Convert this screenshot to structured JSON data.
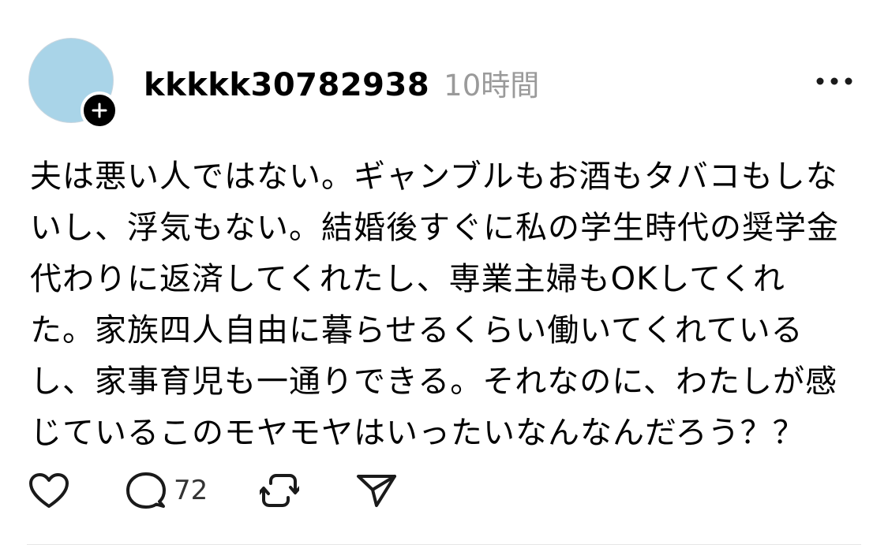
{
  "post": {
    "username": "kkkkk30782938",
    "timestamp": "10時間",
    "body": "夫は悪い人ではない。ギャンブルもお酒もタバコもしな\nいし、浮気もない。結婚後すぐに私の学生時代の奨学金\n代わりに返済してくれたし、専業主婦もOKしてくれ\nた。家族四人自由に暮らせるくらい働いてくれている\nし、家事育児も一通りできる。それなのに、わたしが感\nじているこのモヤモヤはいったいなんなんだろう？？",
    "reply_count": "72"
  },
  "icons": {
    "avatar": "avatar-placeholder",
    "follow": "plus-icon",
    "more": "more-horizontal-icon",
    "like": "heart-icon",
    "reply": "speech-bubble-icon",
    "repost": "repost-icon",
    "share": "send-icon"
  },
  "colors": {
    "avatar_fill": "#a9d4e8",
    "follow_badge": "#000000",
    "timestamp": "#9a9a9a",
    "icon_stroke": "#1a1a1a"
  }
}
